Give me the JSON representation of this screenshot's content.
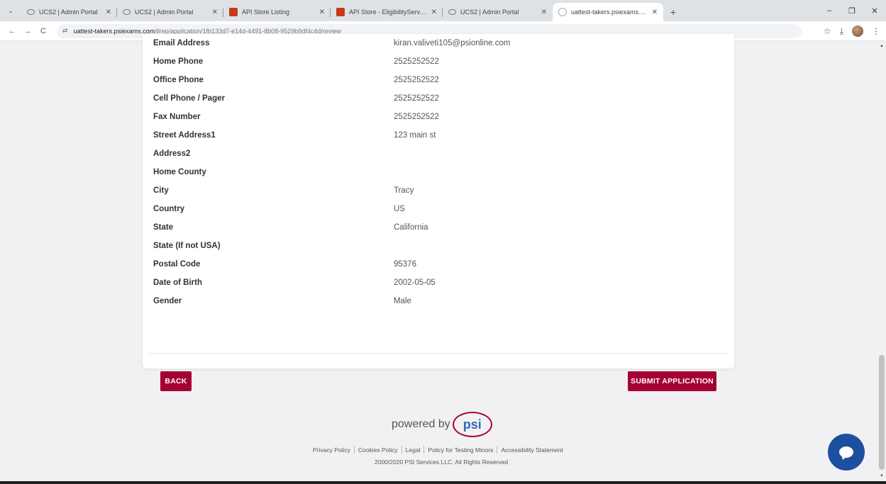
{
  "browser": {
    "tabs": [
      {
        "title": "UCS2 | Admin Portal",
        "icon": "ring-icon",
        "active": false
      },
      {
        "title": "UCS2 | Admin Portal",
        "icon": "ring-icon",
        "active": false
      },
      {
        "title": "API Store Listing",
        "icon": "store-icon",
        "active": false
      },
      {
        "title": "API Store - EligibilityService",
        "icon": "store-icon",
        "active": false
      },
      {
        "title": "UCS2 | Admin Portal",
        "icon": "ring-icon",
        "active": false
      },
      {
        "title": "uattest-takers.psiexams.com/ilr",
        "icon": "psi-icon",
        "active": true
      }
    ],
    "tab_close": "✕",
    "new_tab": "+",
    "menu_icon": "⌄",
    "window": {
      "minimize": "–",
      "restore": "❐",
      "close": "✕"
    },
    "url_host": "uattest-takers.psiexams.com",
    "url_path": "/ilrep/application/1fb133d7-e14d-4491-8b08-9529b9df4c4d/review",
    "nav": {
      "back": "←",
      "forward": "→",
      "reload": "C"
    },
    "site_icon": "⇄",
    "bookmark": "☆",
    "download": "⤓",
    "more": "⋮"
  },
  "review": {
    "fields": [
      {
        "label": "Email Address",
        "value": "kiran.valiveti105@psionline.com"
      },
      {
        "label": "Home Phone",
        "value": "2525252522"
      },
      {
        "label": "Office Phone",
        "value": "2525252522"
      },
      {
        "label": "Cell Phone / Pager",
        "value": "2525252522"
      },
      {
        "label": "Fax Number",
        "value": "2525252522"
      },
      {
        "label": "Street Address1",
        "value": "123 main st"
      },
      {
        "label": "Address2",
        "value": ""
      },
      {
        "label": "Home County",
        "value": ""
      },
      {
        "label": "City",
        "value": "Tracy"
      },
      {
        "label": "Country",
        "value": "US"
      },
      {
        "label": "State",
        "value": "California"
      },
      {
        "label": "State (If not USA)",
        "value": ""
      },
      {
        "label": "Postal Code",
        "value": "95376"
      },
      {
        "label": "Date of Birth",
        "value": "2002-05-05"
      },
      {
        "label": "Gender",
        "value": "Male"
      }
    ],
    "back_label": "BACK",
    "submit_label": "SUBMIT APPLICATION"
  },
  "footer": {
    "powered_by": "powered by",
    "logo_text": "psi",
    "links": [
      "Privacy Policy",
      "Cookies Policy",
      "Legal",
      "Policy for Testing Minors",
      "Accessibility Statement"
    ],
    "copyright": "2000/2020 PSI Services LLC. All Rights Reserved"
  },
  "colors": {
    "accent": "#a50034",
    "chat": "#1d4f9f",
    "logo_text": "#2e6db4"
  }
}
